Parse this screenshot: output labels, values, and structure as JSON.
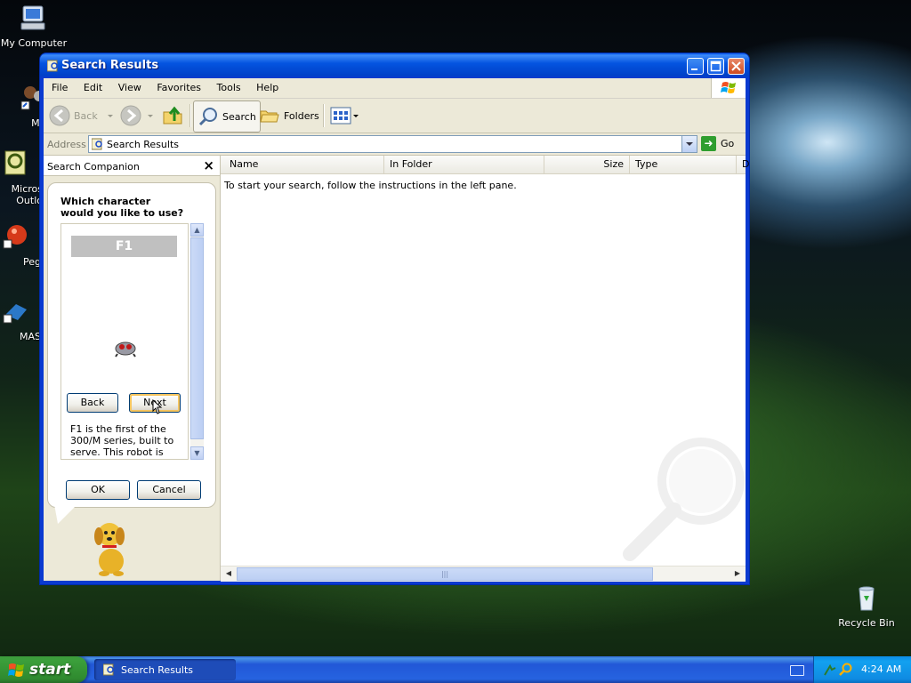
{
  "desktop": {
    "icons": [
      {
        "label": "My Computer"
      },
      {
        "label": "MyPa"
      },
      {
        "label": "Micros\nOutlo"
      },
      {
        "label": "Peg"
      },
      {
        "label": "MAS"
      },
      {
        "label": "Recycle Bin"
      }
    ]
  },
  "window": {
    "title": "Search Results",
    "menu": [
      "File",
      "Edit",
      "View",
      "Favorites",
      "Tools",
      "Help"
    ],
    "toolbar": {
      "back_label": "Back",
      "search_label": "Search",
      "folders_label": "Folders"
    },
    "address": {
      "label": "Address",
      "value": "Search Results",
      "go_label": "Go"
    }
  },
  "search_companion": {
    "title": "Search Companion",
    "question": "Which character would you like to use?",
    "character_name": "F1",
    "back_label": "Back",
    "next_label": "Next",
    "description": "F1 is the first of the 300/M series, built to serve. This robot is fully",
    "ok_label": "OK",
    "cancel_label": "Cancel"
  },
  "results": {
    "columns": [
      "Name",
      "In Folder",
      "Size",
      "Type",
      "D"
    ],
    "message": "To start your search, follow the instructions in the left pane."
  },
  "taskbar": {
    "start_label": "start",
    "task_label": "Search Results",
    "clock": "4:24 AM"
  },
  "colors": {
    "title_blue": "#0454e0",
    "start_green": "#2f8a2f",
    "tray_blue": "#0f8be2"
  }
}
